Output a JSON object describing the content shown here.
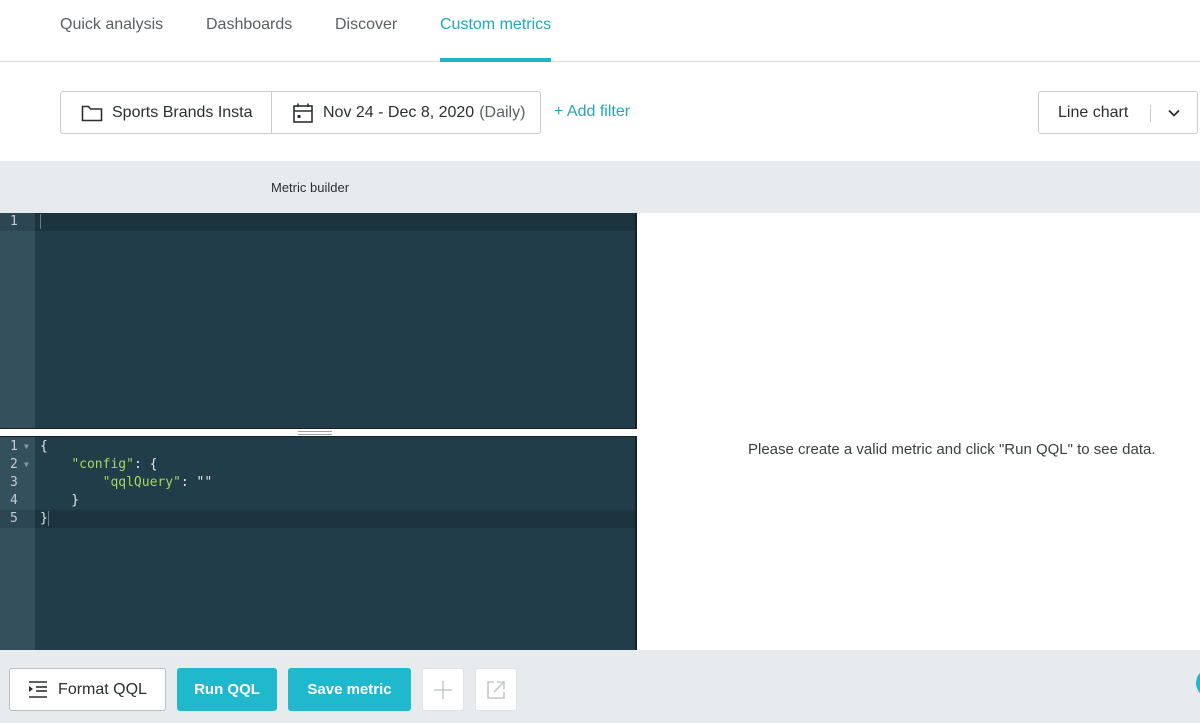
{
  "nav": {
    "tabs": [
      {
        "label": "Quick analysis",
        "active": false
      },
      {
        "label": "Dashboards",
        "active": false
      },
      {
        "label": "Discover",
        "active": false
      },
      {
        "label": "Custom metrics",
        "active": true
      }
    ]
  },
  "toolbar": {
    "source": {
      "icon": "folder-icon",
      "label": "Sports Brands Insta"
    },
    "date_range": {
      "icon": "calendar-icon",
      "label": "Nov 24 - Dec 8, 2020",
      "granularity": "(Daily)"
    },
    "add_filter_label": "+ Add filter",
    "chart_type": {
      "selected": "Line chart",
      "icon": "chevron-down-icon"
    }
  },
  "builder": {
    "title": "Metric builder",
    "top_editor": {
      "lines": [
        {
          "n": "1",
          "text": ""
        }
      ]
    },
    "bottom_editor": {
      "lines": [
        {
          "n": "1",
          "fold": true,
          "text": "{"
        },
        {
          "n": "2",
          "fold": true,
          "indent": "    ",
          "key": "\"config\"",
          "rest": ": {"
        },
        {
          "n": "3",
          "fold": false,
          "indent": "        ",
          "key": "\"qqlQuery\"",
          "rest": ": \"\""
        },
        {
          "n": "4",
          "fold": false,
          "text": "    }"
        },
        {
          "n": "5",
          "fold": false,
          "text": "}"
        }
      ]
    }
  },
  "result": {
    "message": "Please create a valid metric and click \"Run QQL\" to see data."
  },
  "footer": {
    "format_label": "Format QQL",
    "format_icon": "format-indent-icon",
    "run_label": "Run QQL",
    "save_label": "Save metric",
    "add_icon": "plus-icon",
    "open_icon": "open-external-icon"
  },
  "colors": {
    "accent": "#1fb8cd",
    "editor_bg": "#223d4a",
    "string": "#a6d75d"
  }
}
